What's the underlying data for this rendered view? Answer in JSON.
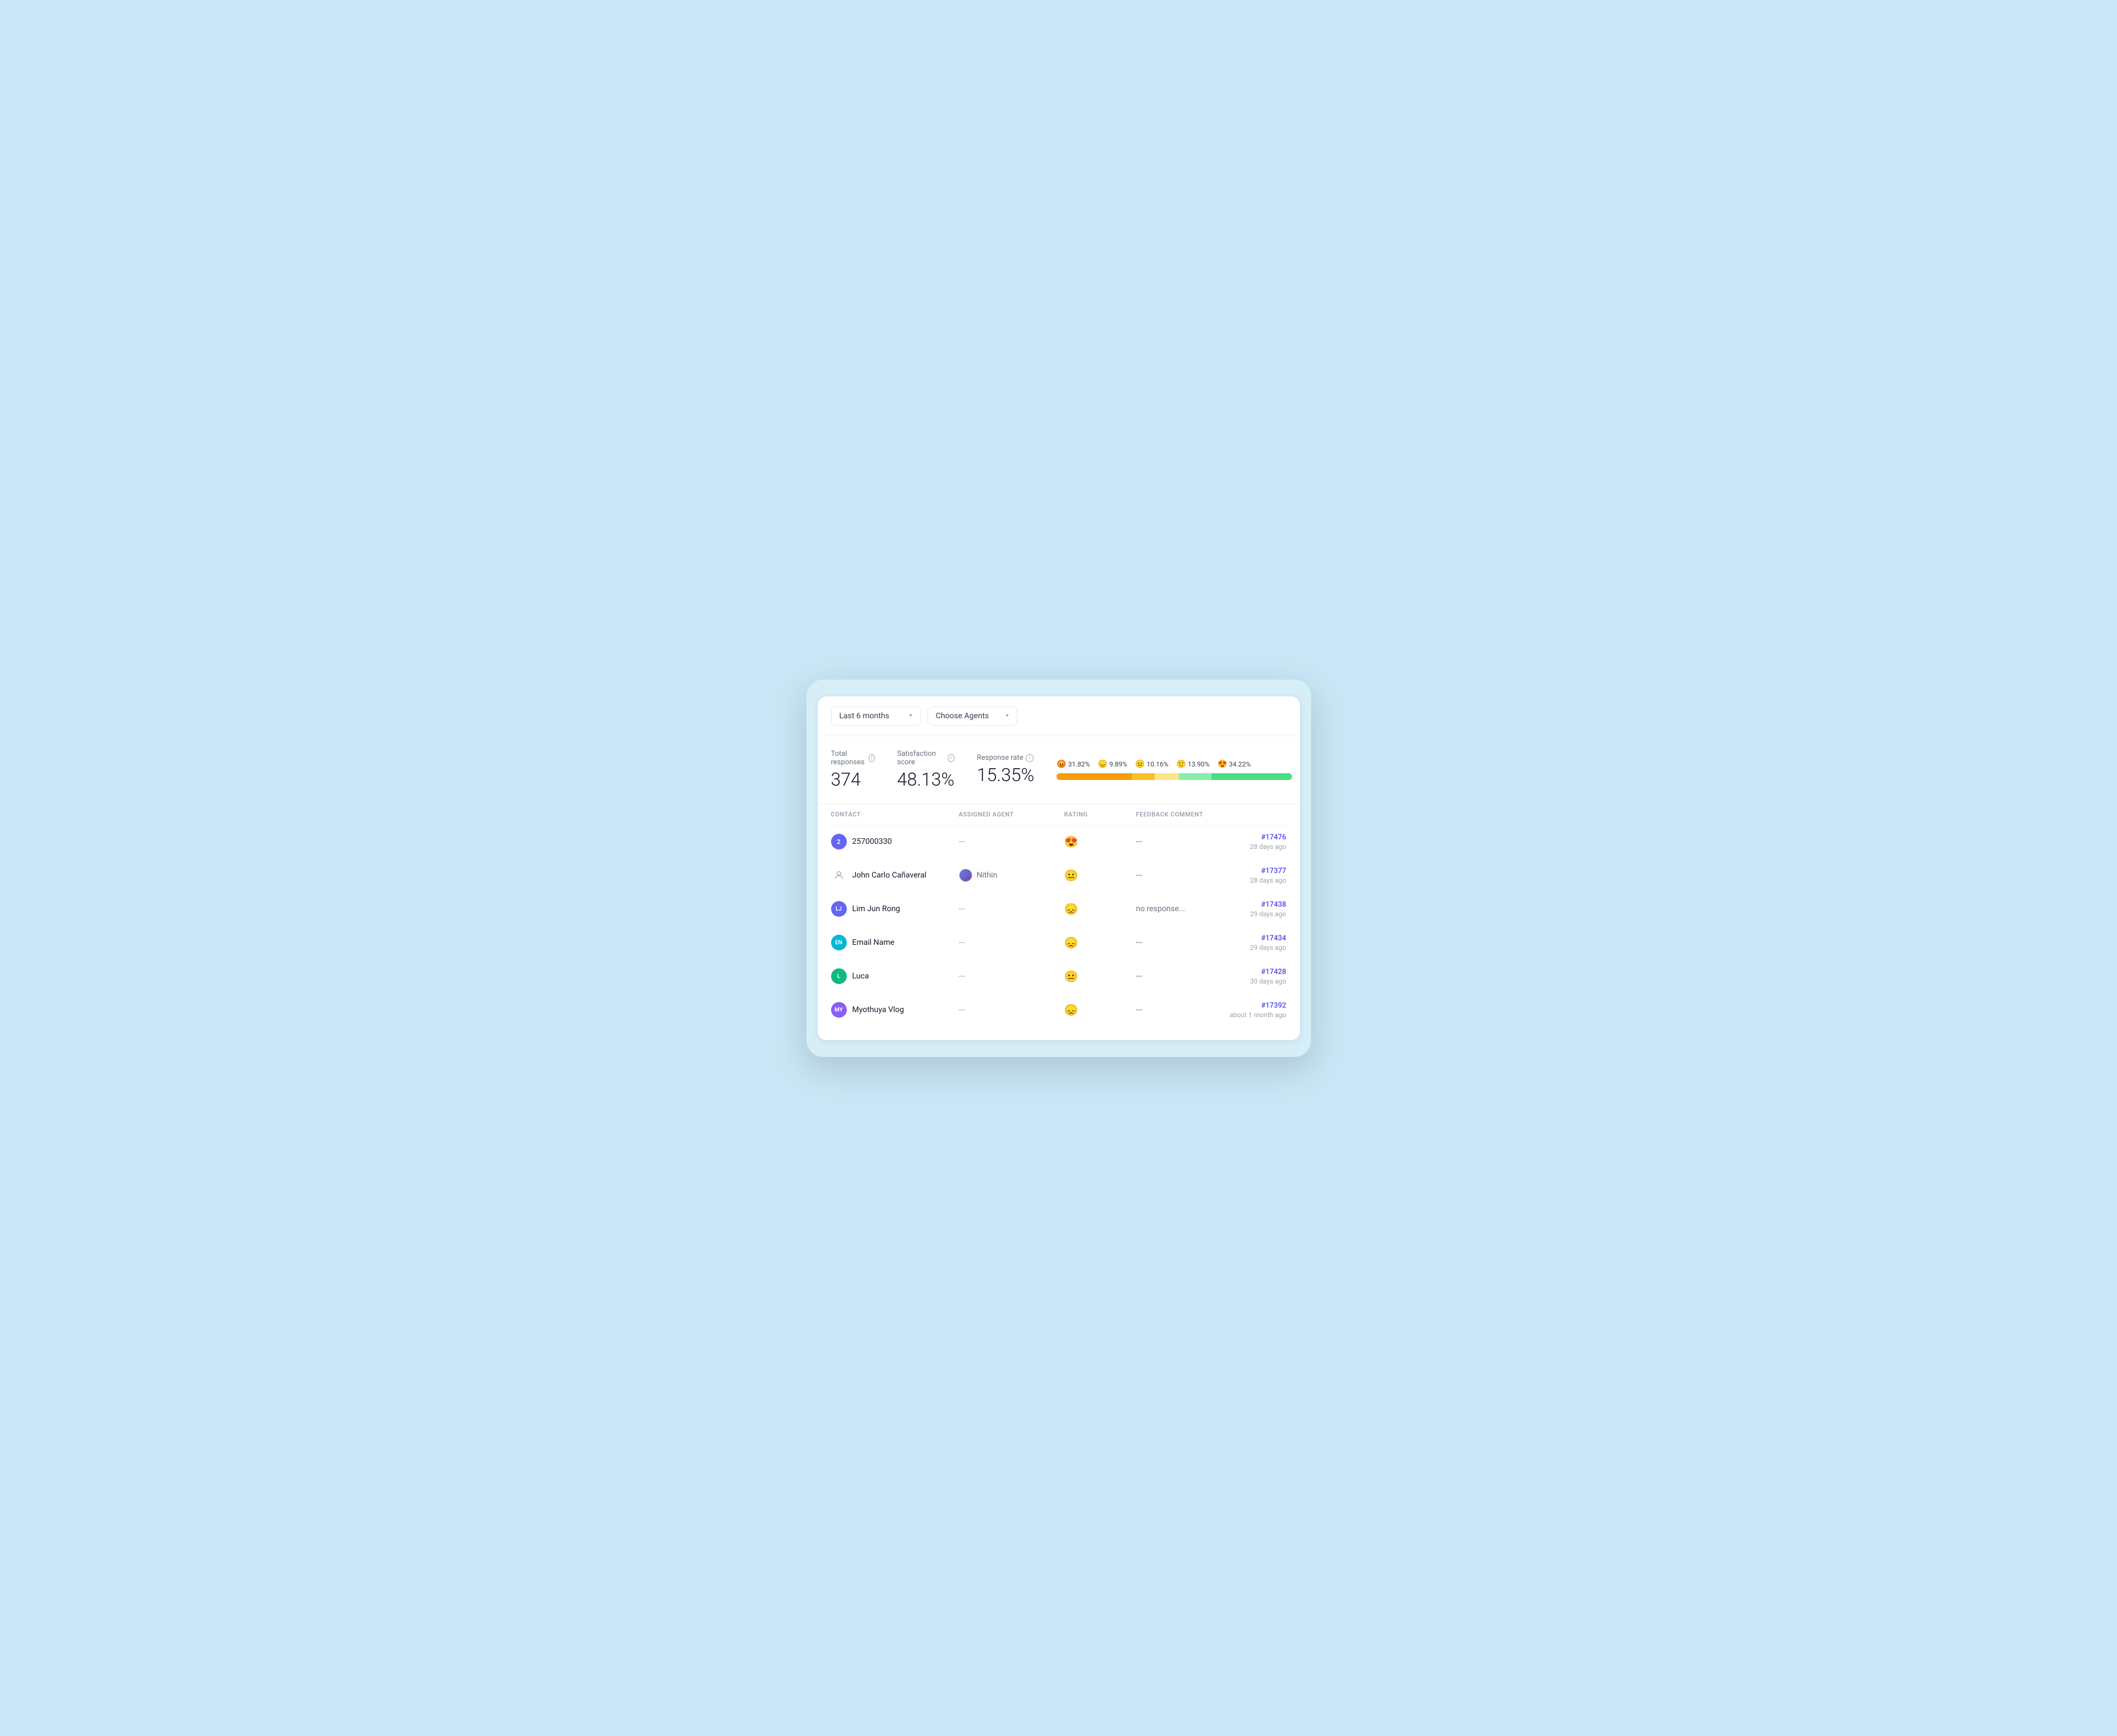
{
  "filters": {
    "time_range": {
      "label": "Last 6 months",
      "chevron": "▾"
    },
    "agents": {
      "label": "Choose Agents",
      "chevron": "▾"
    }
  },
  "stats": {
    "total_responses": {
      "label": "Total responses",
      "value": "374"
    },
    "satisfaction_score": {
      "label": "Satisfaction score",
      "value": "48.13%"
    },
    "response_rate": {
      "label": "Response rate",
      "value": "15.35%"
    }
  },
  "ratings": {
    "items": [
      {
        "emoji": "😡",
        "percent": "31.82%",
        "color": "#f59e0b",
        "width": 31.82
      },
      {
        "emoji": "😞",
        "percent": "9.89%",
        "color": "#fbbf24",
        "width": 9.89
      },
      {
        "emoji": "😐",
        "percent": "10.16%",
        "color": "#fde68a",
        "width": 10.16
      },
      {
        "emoji": "🙂",
        "percent": "13.90%",
        "color": "#86efac",
        "width": 13.9
      },
      {
        "emoji": "😍",
        "percent": "34.22%",
        "color": "#4ade80",
        "width": 34.22
      }
    ]
  },
  "table": {
    "headers": [
      "CONTACT",
      "ASSIGNED AGENT",
      "RATING",
      "FEEDBACK COMMENT",
      ""
    ],
    "rows": [
      {
        "contact_avatar_type": "number",
        "contact_avatar_text": "2",
        "contact_avatar_bg": "#6366f1",
        "contact_name": "257000330",
        "agent": "---",
        "agent_has_avatar": false,
        "rating_emoji": "😍",
        "feedback": "---",
        "ticket_id": "#17476",
        "ticket_time": "28 days ago"
      },
      {
        "contact_avatar_type": "person",
        "contact_avatar_text": "",
        "contact_avatar_bg": "",
        "contact_name": "John Carlo Cañaveral",
        "agent": "Nithin",
        "agent_has_avatar": true,
        "rating_emoji": "😐",
        "feedback": "---",
        "ticket_id": "#17377",
        "ticket_time": "28 days ago"
      },
      {
        "contact_avatar_type": "initials",
        "contact_avatar_text": "LJ",
        "contact_avatar_bg": "#6366f1",
        "contact_name": "Lim Jun Rong",
        "agent": "---",
        "agent_has_avatar": false,
        "rating_emoji": "😞",
        "feedback": "no response...",
        "ticket_id": "#17438",
        "ticket_time": "29 days ago"
      },
      {
        "contact_avatar_type": "initials",
        "contact_avatar_text": "EN",
        "contact_avatar_bg": "#06b6d4",
        "contact_name": "Email Name",
        "agent": "---",
        "agent_has_avatar": false,
        "rating_emoji": "😞",
        "feedback": "---",
        "ticket_id": "#17434",
        "ticket_time": "29 days ago"
      },
      {
        "contact_avatar_type": "initials",
        "contact_avatar_text": "L",
        "contact_avatar_bg": "#10b981",
        "contact_name": "Luca",
        "agent": "---",
        "agent_has_avatar": false,
        "rating_emoji": "😐",
        "feedback": "---",
        "ticket_id": "#17428",
        "ticket_time": "30 days ago"
      },
      {
        "contact_avatar_type": "initials",
        "contact_avatar_text": "MY",
        "contact_avatar_bg": "#8b5cf6",
        "contact_name": "Myothuya Vlog",
        "agent": "---",
        "agent_has_avatar": false,
        "rating_emoji": "😞",
        "feedback": "---",
        "ticket_id": "#17392",
        "ticket_time": "about 1 month ago"
      }
    ]
  }
}
